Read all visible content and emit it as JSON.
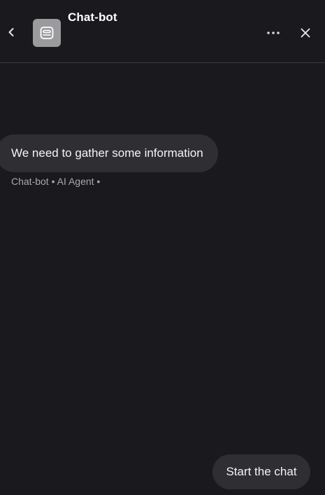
{
  "header": {
    "title": "Chat-bot",
    "avatar_icon": "robot-icon",
    "back_icon": "chevron-left-icon",
    "more_icon": "more-horizontal-icon",
    "close_icon": "close-icon"
  },
  "messages": [
    {
      "text": "We need to gather some information",
      "meta": "Chat-bot • AI Agent •"
    }
  ],
  "actions": {
    "start_label": "Start the chat"
  },
  "colors": {
    "background": "#1a1a1e",
    "bubble": "#2f2f33",
    "avatar": "#9b9b9e",
    "meta_text": "#a8a8ad"
  }
}
